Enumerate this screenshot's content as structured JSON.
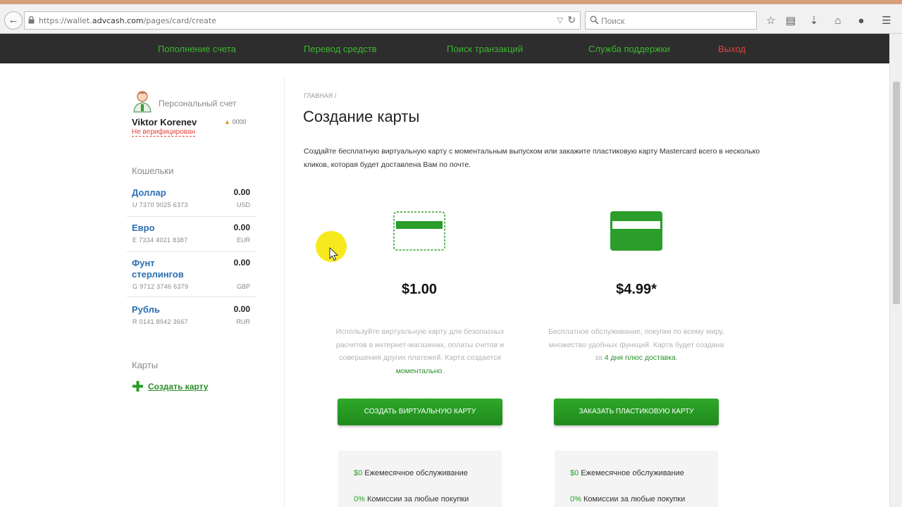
{
  "browser": {
    "url_prefix": "https://wallet.",
    "url_domain": "advcash.com",
    "url_path": "/pages/card/create",
    "search_placeholder": "Поиск"
  },
  "nav": {
    "items": [
      "Пополнение счета",
      "Перевод средств",
      "Поиск транзакций",
      "Служба поддержки"
    ],
    "exit": "Выход"
  },
  "profile": {
    "account_type": "Персональный счет",
    "name": "Viktor Korenev",
    "status": "Не верифицирован",
    "points": "0000"
  },
  "wallets_title": "Кошельки",
  "wallets": [
    {
      "name": "Доллар",
      "amount": "0.00",
      "number": "U 7370 9025 6373",
      "currency": "USD"
    },
    {
      "name": "Евро",
      "amount": "0.00",
      "number": "E 7334 4021 8387",
      "currency": "EUR"
    },
    {
      "name": "Фунт стерлингов",
      "amount": "0.00",
      "number": "G 9712 3746 6379",
      "currency": "GBP"
    },
    {
      "name": "Рубль",
      "amount": "0.00",
      "number": "R 0141 8942 3667",
      "currency": "RUR"
    }
  ],
  "cards_title": "Карты",
  "create_card_link": "Создать карту",
  "breadcrumb": "главная /",
  "page_title": "Создание карты",
  "intro": "Создайте бесплатную виртуальную карту с моментальным выпуском или закажите пластиковую карту Mastercard всего в несколько кликов, которая будет доставлена Вам по почте.",
  "virtual": {
    "price": "$1.00",
    "desc": "Используйте виртуальную карту для безопасных расчетов в интернет-магазинах, оплаты счетов и совершения других платежей. Карта создается ",
    "desc_hl": "моментально",
    "desc_end": ".",
    "button": "Создать виртуальную карту",
    "feat1_val": "$0",
    "feat1_text": " Ежемесячное обслуживание",
    "feat2_val": "0%",
    "feat2_text": " Комиссии за любые покупки"
  },
  "plastic": {
    "price": "$4.99*",
    "desc": "Бесплатное обслуживание, покупки по всему миру, множество удобных функций. Карта будет создана за ",
    "desc_hl": "4 дня плюс доставка",
    "desc_end": ".",
    "button": "Заказать пластиковую карту",
    "feat1_val": "$0",
    "feat1_text": " Ежемесячное обслуживание",
    "feat2_val": "0%",
    "feat2_text": " Комиссии за любые покупки"
  },
  "colors": {
    "accent_green": "#2a9d2a",
    "nav_bg": "#2d2d2d",
    "nav_link": "#3cb72e",
    "exit_red": "#e0453a",
    "cursor_highlight": "#f6ea1f"
  }
}
